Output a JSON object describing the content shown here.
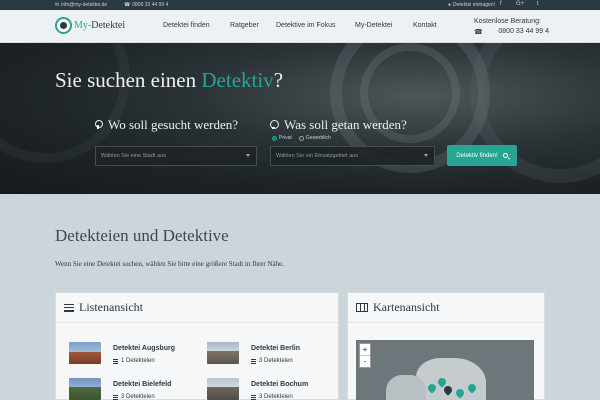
{
  "topbar": {
    "email": "info@my-detektei.de",
    "phone": "0800 33 44 99 4",
    "register": "Detektei eintragen!",
    "social": [
      "f",
      "G+",
      "t"
    ]
  },
  "nav": {
    "logo_brand": "My-",
    "logo_name": "Detektei",
    "items": [
      "Detektei finden",
      "Ratgeber",
      "Detektive im Fokus",
      "My-Detektei",
      "Kontakt"
    ],
    "cta_label": "Kostenlose Beratung:",
    "cta_phone": "0800 33 44 99 4"
  },
  "hero": {
    "headline_before": "Sie suchen einen ",
    "headline_accent": "Detektiv",
    "headline_after": "?",
    "where_label": "Wo soll gesucht werden?",
    "what_label": "Was soll getan werden?",
    "radio_private": "Privat",
    "radio_business": "Gewerblich",
    "city_placeholder": "Wählen Sie eine Stadt aus",
    "area_placeholder": "Wählen Sie ein Einsatzgebiet aus",
    "search_button": "Detektiv finden!"
  },
  "content": {
    "title": "Detekteien und Detektive",
    "intro": "Wenn Sie eine Detektei suchen, wählen Sie bitte eine größere Stadt in Ihrer Nähe."
  },
  "list_panel": {
    "title": "Listenansicht",
    "cities": [
      {
        "name": "Detektei Augsburg",
        "count": "1 Detekteien"
      },
      {
        "name": "Detektei Berlin",
        "count": "3 Detekteien"
      },
      {
        "name": "Detektei Bielefeld",
        "count": "3 Detekteien"
      },
      {
        "name": "Detektei Bochum",
        "count": "3 Detekteien"
      }
    ]
  },
  "map_panel": {
    "title": "Kartenansicht",
    "zoom_in": "+",
    "zoom_out": "-"
  },
  "colors": {
    "accent": "#28a592",
    "dark": "#2b3a40"
  }
}
